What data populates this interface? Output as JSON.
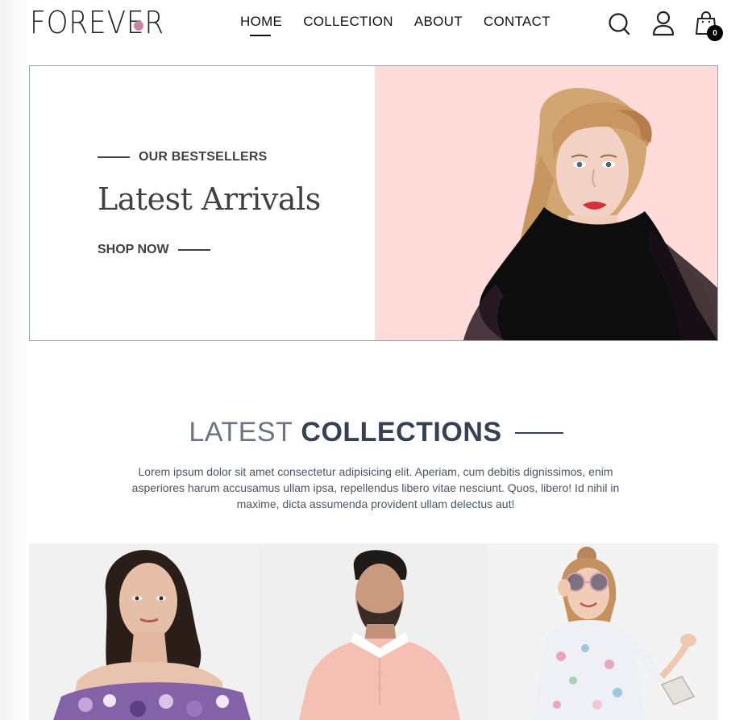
{
  "header": {
    "logo_text": "FOREVER",
    "nav": [
      {
        "label": "HOME",
        "active": true
      },
      {
        "label": "COLLECTION",
        "active": false
      },
      {
        "label": "ABOUT",
        "active": false
      },
      {
        "label": "CONTACT",
        "active": false
      }
    ],
    "cart_count": "0",
    "icons": [
      "search-icon",
      "profile-icon",
      "cart-icon"
    ]
  },
  "hero": {
    "eyebrow": "OUR BESTSELLERS",
    "title": "Latest Arrivals",
    "cta": "SHOP NOW",
    "image_bg": "#ffdbd9"
  },
  "collections": {
    "title_light": "LATEST",
    "title_bold": "COLLECTIONS",
    "description": "Lorem ipsum dolor sit amet consectetur adipisicing elit. Aperiam, cum debitis dignissimos, enim asperiores harum accusamus ullam ipsa, repellendus libero vitae nesciunt. Quos, libero! Id nihil in maxime, dicta assumenda provident ullam delectus aut!"
  },
  "colors": {
    "accent_dot": "#c586a5",
    "text_dark": "#414141",
    "hero_pink": "#ffdbd9"
  }
}
